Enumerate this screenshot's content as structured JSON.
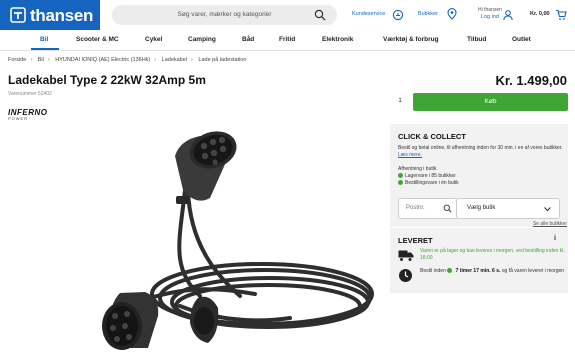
{
  "header": {
    "logo_text": "thansen",
    "search_placeholder": "Søg varer, mærker og kategorier",
    "customer_service": "Kundeservice",
    "stores": "Butikker",
    "login_line1": "Hi thansen",
    "login_line2": "Log ind",
    "cart_total": "Kr. 0,00",
    "accent_color": "#1565c0"
  },
  "nav": {
    "items": [
      "Bil",
      "Scooter & MC",
      "Cykel",
      "Camping",
      "Båd",
      "Fritid",
      "Elektronik",
      "Værktøj & forbrug",
      "Tilbud",
      "Outlet"
    ],
    "active": "Bil"
  },
  "breadcrumb": [
    "Forside",
    "Bil",
    "HYUNDAI IONIQ (AE) Electric (136Hk)",
    "Ladekabel",
    "Lade på ladestation"
  ],
  "product": {
    "title": "Ladekabel Type 2 22kW 32Amp 5m",
    "sku": "Varenummer 52402",
    "price": "Kr. 1.499,00",
    "quantity": "1",
    "buy_label": "Køb",
    "brand_name": "INFERNO",
    "brand_sub": "POWER"
  },
  "click_collect": {
    "title": "CLICK & COLLECT",
    "description": "Bestil og betal online, til afhentning inden for 30 min. i en af vores butikker.",
    "read_more": "Læs mere.",
    "pickup_label": "Afhentning i butik",
    "stock_stores": "Lagervare i 85 butikker",
    "order_in_store": "Bestillingsvare i én butik",
    "postcode_placeholder": "Postnr.",
    "store_select": "Vælg butik",
    "see_all": "Se alle butikker"
  },
  "delivery": {
    "title": "LEVERET",
    "info_icon": "i",
    "stock_text": "Varen er på lager og kan leveres i morgen, ved bestilling inden kl. 18:00",
    "order_prefix": "Bestil inden",
    "countdown": "7 timer 17 min. 6 s.",
    "order_suffix": "og få varen leveret i morgen"
  }
}
